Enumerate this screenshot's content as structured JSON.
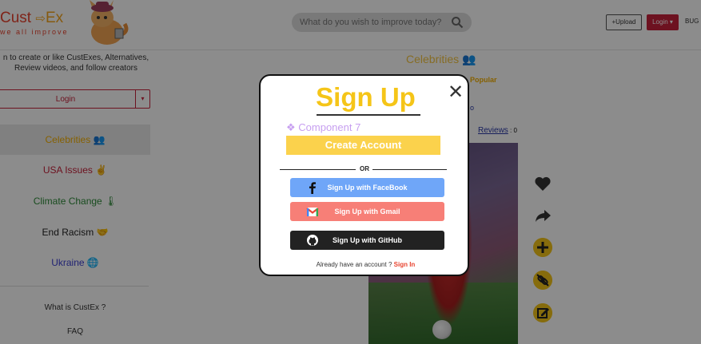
{
  "header": {
    "logo_left": "Cust",
    "logo_arrow": "⇨",
    "logo_right": "Ex",
    "tagline": "we all improve",
    "search_placeholder": "What do you wish to improve today?",
    "upload_label": "+Upload",
    "login_label": "Login ▾",
    "bug_label": "BUG"
  },
  "sidebar": {
    "intro": "n to create or like CustExes, Alternatives, Review videos, and follow creators",
    "login_label": "Login",
    "login_caret": "▾",
    "categories": [
      {
        "label": "Celebrities 👥",
        "color": "#f4b000"
      },
      {
        "label": "USA Issues ✌",
        "color": "#c7213b"
      },
      {
        "label": "Climate Change 🌡",
        "color": "#2e8b3a"
      },
      {
        "label": "End Racism 🤝",
        "color": "#222222"
      },
      {
        "label": "Ukraine 🌐",
        "color": "#3b3fd1"
      }
    ],
    "links": [
      "What is CustEx ?",
      "FAQ"
    ]
  },
  "main": {
    "title": "Celebrities 👥",
    "popular": "Popular",
    "video_link": "o",
    "reviews_label": "Reviews",
    "reviews_sep": " : ",
    "reviews_count": "0"
  },
  "modal": {
    "title": "Sign Up",
    "component_label": "❖ Component 7",
    "create_label": "Create Account",
    "or_label": "OR",
    "facebook_label": "Sign Up with FaceBook",
    "gmail_label": "Sign Up with Gmail",
    "github_label": "Sign Up with GitHub",
    "have_account": "Already have an account ?",
    "sign_in": "Sign In",
    "close_glyph": "✕"
  },
  "colors": {
    "accent_yellow": "#f5c518",
    "brand_red": "#c7213b",
    "facebook": "#6fa6f8",
    "gmail": "#f77f77",
    "github": "#222222"
  }
}
